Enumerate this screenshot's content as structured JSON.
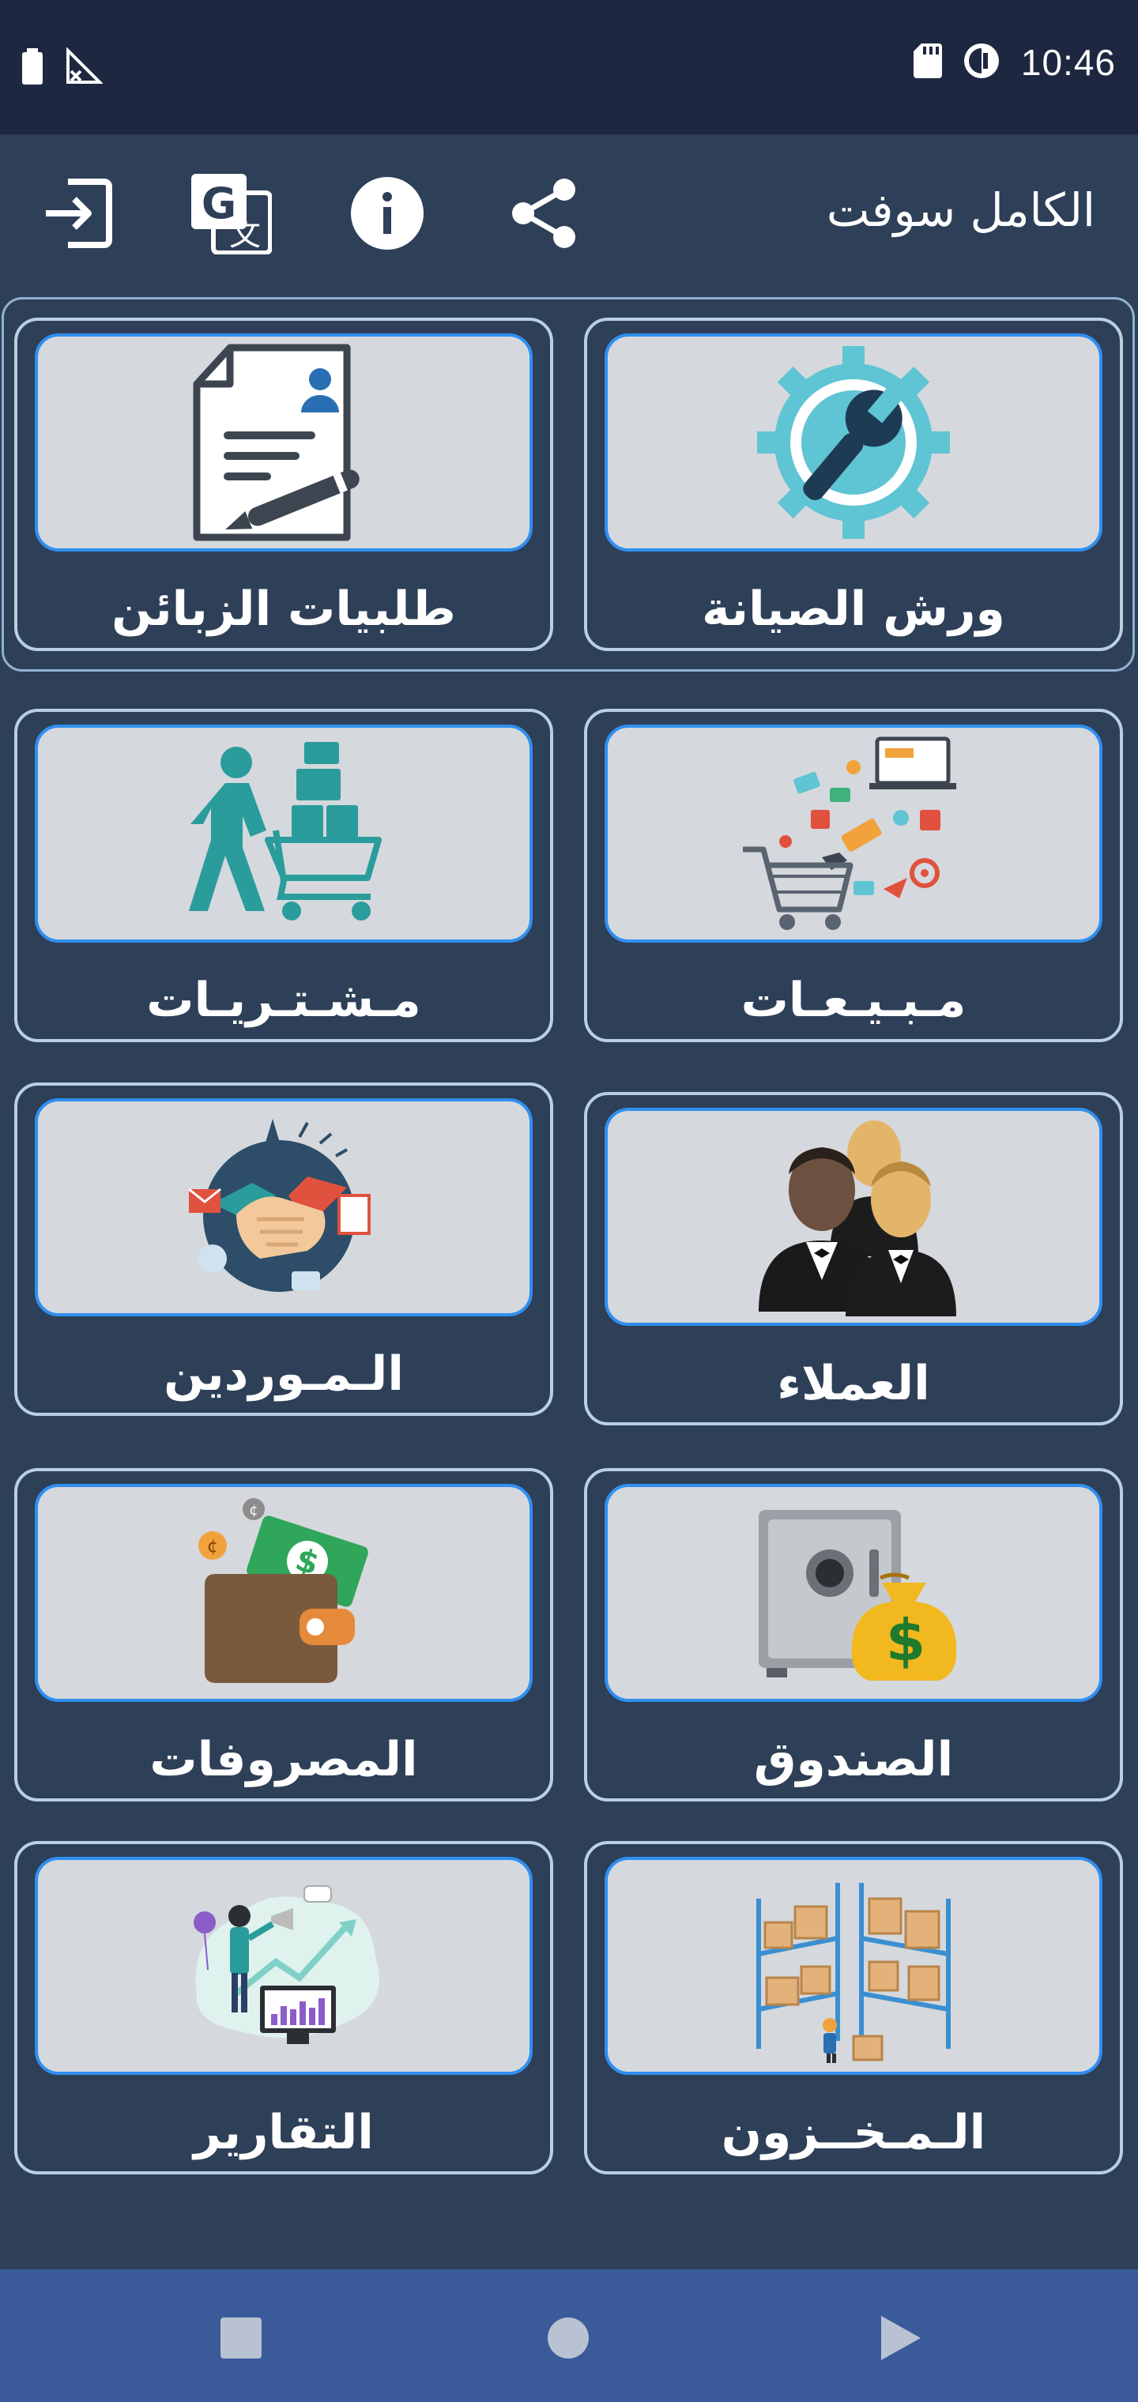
{
  "status_bar": {
    "time": "10:46",
    "icons": [
      "battery-icon",
      "no-signal-icon",
      "sd-card-icon",
      "data-saver-icon"
    ]
  },
  "app_bar": {
    "title": "الكامل سوفت",
    "actions": [
      "share-icon",
      "info-icon",
      "translate-icon",
      "logout-icon"
    ]
  },
  "menu": {
    "items": [
      {
        "label": "ورش الصيانة",
        "icon": "maintenance-gear-icon"
      },
      {
        "label": "طلبيات الزبائن",
        "icon": "customer-order-document-icon"
      },
      {
        "label": "مـبـيـعـات",
        "icon": "sales-shopping-icon"
      },
      {
        "label": "مـشـتـريـات",
        "icon": "purchases-cart-icon"
      },
      {
        "label": "العملاء",
        "icon": "customers-people-icon"
      },
      {
        "label": "الـمـوردين",
        "icon": "suppliers-handshake-icon"
      },
      {
        "label": "الصندوق",
        "icon": "cashbox-safe-icon"
      },
      {
        "label": "المصروفات",
        "icon": "expenses-wallet-icon"
      },
      {
        "label": "الـمـخــزون",
        "icon": "inventory-warehouse-icon"
      },
      {
        "label": "التقارير",
        "icon": "reports-analytics-icon"
      }
    ]
  },
  "nav_bar": {
    "buttons": [
      "recents-square-icon",
      "home-circle-icon",
      "back-triangle-icon"
    ]
  },
  "colors": {
    "background": "#2e3f58",
    "status_bar": "#1d2740",
    "card_image_bg": "#d5d8dd",
    "card_image_border": "#2f8ff0",
    "card_border": "#b9d0e2",
    "nav_bar": "#3a5a9a"
  }
}
